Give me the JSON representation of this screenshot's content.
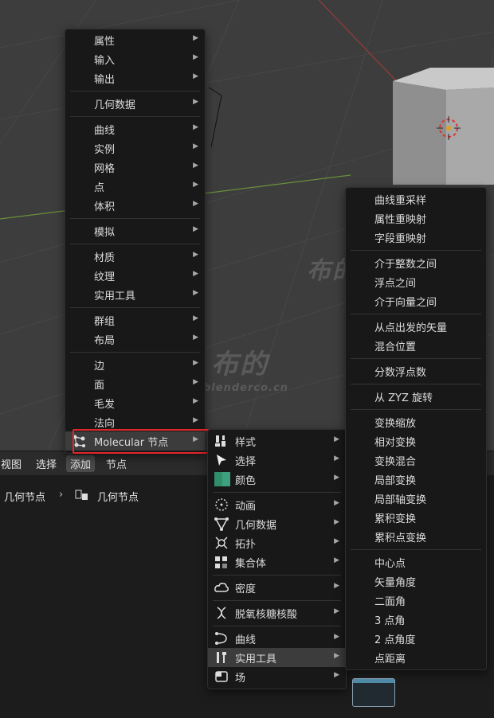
{
  "add_menu": {
    "items": [
      {
        "label": "属性"
      },
      {
        "label": "输入"
      },
      {
        "label": "输出"
      },
      {
        "label": "几何数据"
      },
      {
        "label": "曲线"
      },
      {
        "label": "实例"
      },
      {
        "label": "网格"
      },
      {
        "label": "点"
      },
      {
        "label": "体积"
      },
      {
        "label": "模拟"
      },
      {
        "label": "材质"
      },
      {
        "label": "纹理"
      },
      {
        "label": "实用工具"
      },
      {
        "label": "群组"
      },
      {
        "label": "布局"
      },
      {
        "label": "边"
      },
      {
        "label": "面"
      },
      {
        "label": "毛发"
      },
      {
        "label": "法向"
      },
      {
        "label": "Molecular 节点"
      }
    ]
  },
  "molecular_menu": {
    "items": [
      {
        "label": "样式",
        "icon": "brush-icon"
      },
      {
        "label": "选择",
        "icon": "cursor-icon"
      },
      {
        "label": "颜色",
        "icon": "color-swatch-icon"
      },
      {
        "label": "动画",
        "icon": "animation-circle-icon"
      },
      {
        "label": "几何数据",
        "icon": "geometry-nodes-icon"
      },
      {
        "label": "拓扑",
        "icon": "topology-icon"
      },
      {
        "label": "集合体",
        "icon": "assembly-icon"
      },
      {
        "label": "密度",
        "icon": "cloud-density-icon"
      },
      {
        "label": "脱氧核糖核酸",
        "icon": "dna-icon"
      },
      {
        "label": "曲线",
        "icon": "curve-icon"
      },
      {
        "label": "实用工具",
        "icon": "utilities-icon"
      },
      {
        "label": "场",
        "icon": "field-icon"
      }
    ]
  },
  "utilities_menu": {
    "items": [
      {
        "label": "曲线重采样"
      },
      {
        "label": "属性重映射"
      },
      {
        "label": "字段重映射"
      },
      {
        "label": "介于整数之间"
      },
      {
        "label": "浮点之间"
      },
      {
        "label": "介于向量之间"
      },
      {
        "label": "从点出发的矢量"
      },
      {
        "label": "混合位置"
      },
      {
        "label": "分数浮点数"
      },
      {
        "label": "从 ZYZ 旋转"
      },
      {
        "label": "变换缩放"
      },
      {
        "label": "相对变换"
      },
      {
        "label": "变换混合"
      },
      {
        "label": "局部变换"
      },
      {
        "label": "局部轴变换"
      },
      {
        "label": "累积变换"
      },
      {
        "label": "累积点变换"
      },
      {
        "label": "中心点"
      },
      {
        "label": "矢量角度"
      },
      {
        "label": "二面角"
      },
      {
        "label": "3 点角"
      },
      {
        "label": "2 点角度"
      },
      {
        "label": "点距离"
      }
    ]
  },
  "node_header": {
    "view": "视图",
    "select": "选择",
    "add": "添加",
    "node": "节点"
  },
  "breadcrumb": {
    "first": "几何节点",
    "second": "几何节点"
  },
  "watermarks": {
    "site": "blenderco.cn",
    "brand": "布的"
  },
  "colors": {
    "menu_bg": "#181818",
    "highlight": "#3c3c3c",
    "red_box": "#e0262b"
  }
}
